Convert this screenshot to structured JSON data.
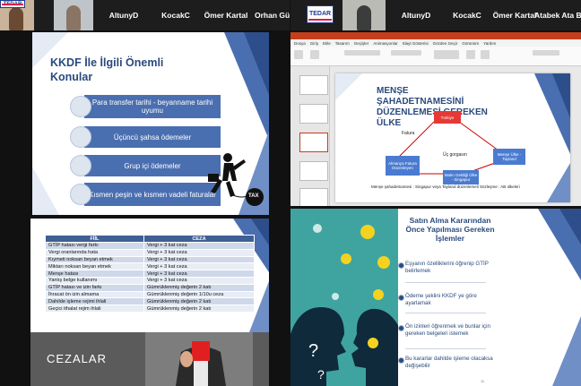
{
  "participants_left": {
    "tiles": [
      "AltunyD",
      "KocakC",
      "Ömer Kartal",
      "Orhan Güne"
    ],
    "logo": "TEDAR"
  },
  "participants_right": {
    "tiles": [
      "AltunyD",
      "KocakC",
      "Ömer Kartal",
      "Atabek Ata Bo"
    ],
    "logo": "TEDAR"
  },
  "slide_kkdf": {
    "title": "KKDF İle İlgili Önemli Konular",
    "items": [
      "Para transfer tarihi - beyanname tarihi uyumu",
      "Üçüncü şahsa ödemeler",
      "Grup içi ödemeler",
      "Kısmen peşin ve kısmen vadeli faturalar"
    ],
    "tax_label": "TAX"
  },
  "powerpoint": {
    "tabs": [
      "Dosya",
      "Giriş",
      "Ekle",
      "Tasarım",
      "Geçişler",
      "Animasyonlar",
      "Slayt Gösterisi",
      "Gözden Geçir",
      "Görünüm",
      "Yardım"
    ],
    "slide": {
      "title": "MENŞE ŞAHADETNAMESİNİ DÜZENLEMESİ GEREKEN ÜLKE",
      "nodes": {
        "turkey": "Türkiye",
        "germany": "Almanya Fatura Düzenleyen",
        "goods_origin": "Malın Geldiği Ülke - Singapur",
        "invoice_recipient": "Menşe Ülke - Tayland"
      },
      "label_invoice": "Fatura",
      "label_consignment": "Üç gorgasın",
      "footer": "Menşe şahadetnamesi : Singapur veya Tayland düzenlemeli Sözleşme : AB ülkeleri"
    }
  },
  "penalties_table": {
    "headers": [
      "FİİL",
      "CEZA"
    ],
    "rows": [
      [
        "GTİP hatası vergi farkı",
        "Vergi + 3 kat ceza"
      ],
      [
        "Vergi oranlarında hata",
        "Vergi + 3 kat ceza"
      ],
      [
        "Kıymeti noksan beyan etmek",
        "Vergi + 3 kat ceza"
      ],
      [
        "Miktarı noksan beyan etmek",
        "Vergi + 3 kat ceza"
      ],
      [
        "Menşe hatası",
        "Vergi + 3 kat ceza"
      ],
      [
        "Yanlış belge kullanımı",
        "Vergi + 3 kat ceza"
      ],
      [
        "GTİP hatası ve izin farkı",
        "Gümrüklenmiş değerin 2 katı"
      ],
      [
        "İhracat ön izin almama",
        "Gümrüklenmiş değerin 1/10u ceza"
      ],
      [
        "Dahilde işleme rejimi ihlali",
        "Gümrüklenmiş değerin 2 katı"
      ],
      [
        "Geçici ithalat rejim ihlali",
        "Gümrüklenmiş değerin 2 katı"
      ]
    ],
    "band_title": "CEZALAR"
  },
  "slide_purchase": {
    "title": "Satın Alma Kararından Önce Yapılması Gereken İşlemler",
    "items": [
      "Eşyanın özelliklerini öğrenip GTİP belirlemek",
      "Ödeme şeklini KKDF ye göre ayarlamak",
      "Ön izinleri öğrenmek ve bunlar için gereken belgeleri istemek",
      "Bu kararlar dahilde işleme olacaksa değişebilir"
    ],
    "page_number": "11"
  },
  "colors": {
    "slide_blue": "#4a6fb0",
    "title_navy": "#2a4a7d",
    "ppt_red": "#c43e1c",
    "teal": "#3fa4a0"
  }
}
